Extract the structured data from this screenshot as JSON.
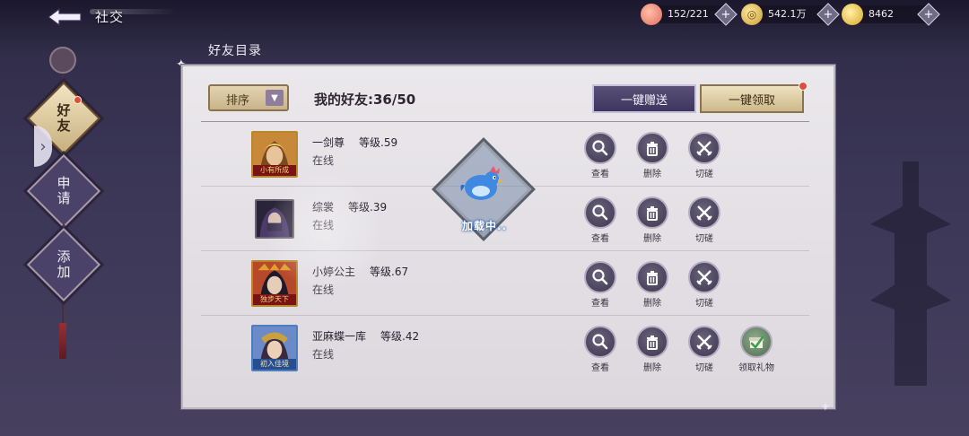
{
  "header": {
    "title": "社交"
  },
  "resources": [
    {
      "icon": "peach-icon",
      "value": "152/221"
    },
    {
      "icon": "coin-icon",
      "value": "542.1万"
    },
    {
      "icon": "gold-ingot-icon",
      "value": "8462"
    }
  ],
  "nav": {
    "items": [
      {
        "label": "好友",
        "active": true,
        "has_dot": true
      },
      {
        "label": "申请",
        "active": false,
        "has_dot": false
      },
      {
        "label": "添加",
        "active": false,
        "has_dot": false
      }
    ]
  },
  "panel": {
    "title": "好友目录",
    "sort_label": "排序",
    "friends_count": "我的好友:36/50",
    "send_all_label": "一键赠送",
    "claim_all_label": "一键领取"
  },
  "actions": {
    "view": "查看",
    "delete": "删除",
    "spar": "切磋",
    "claim_gift": "领取礼物"
  },
  "friends": [
    {
      "name": "一剑尊",
      "level": "等级.59",
      "status": "在线",
      "banner": "小有所成",
      "has_gift": false
    },
    {
      "name": "综裳",
      "level": "等级.39",
      "status": "在线",
      "banner": "",
      "has_gift": false
    },
    {
      "name": "小婷公主",
      "level": "等级.67",
      "status": "在线",
      "banner": "独步天下",
      "has_gift": false
    },
    {
      "name": "亚麻蝶一库",
      "level": "等级.42",
      "status": "在线",
      "banner": "初入佳境",
      "has_gift": true
    }
  ],
  "loading": {
    "text": "加载中.."
  },
  "colors": {
    "accent_gold": "#c9b389",
    "accent_purple": "#4a4268",
    "notice_red": "#e24c3a"
  }
}
